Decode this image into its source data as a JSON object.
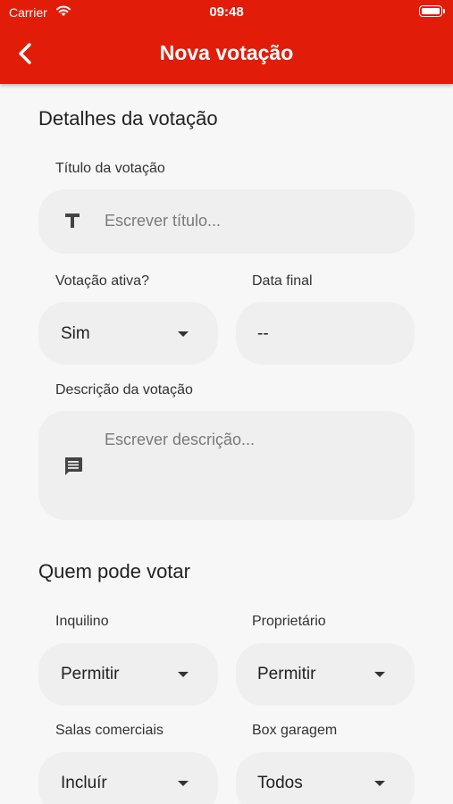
{
  "status_bar": {
    "carrier": "Carrier",
    "time": "09:48"
  },
  "app_bar": {
    "title": "Nova votação"
  },
  "details": {
    "section_title": "Detalhes da votação",
    "title_label": "Título da votação",
    "title_placeholder": "Escrever título...",
    "active_label": "Votação ativa?",
    "active_value": "Sim",
    "end_date_label": "Data final",
    "end_date_value": "--",
    "description_label": "Descrição da votação",
    "description_placeholder": "Escrever descrição..."
  },
  "voters": {
    "section_title": "Quem pode votar",
    "tenant_label": "Inquilino",
    "tenant_value": "Permitir",
    "owner_label": "Proprietário",
    "owner_value": "Permitir",
    "commercial_label": "Salas comerciais",
    "commercial_value": "Incluír",
    "garage_label": "Box garagem",
    "garage_value": "Todos"
  },
  "colors": {
    "primary": "#e11d0a",
    "field_bg": "#efefef",
    "background": "#f7f7f7"
  }
}
